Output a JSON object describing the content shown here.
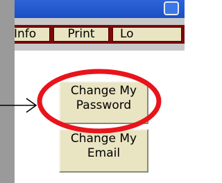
{
  "titlebar": {
    "button_icon": "window-restore-icon",
    "color": "#1a4fc4"
  },
  "nav": {
    "tabs": [
      {
        "label": "Info"
      },
      {
        "label": "Print"
      },
      {
        "label": "Lo"
      }
    ],
    "bar_color": "#7a0a0a",
    "tab_color": "#e9e4c2"
  },
  "actions": {
    "change_password": {
      "line1": "Change My",
      "line2": "Password"
    },
    "change_email": {
      "line1": "Change My",
      "line2": "Email"
    }
  },
  "annotation": {
    "highlight_color": "#e8141c",
    "arrow_icon": "arrow-right-icon",
    "circle_icon": "highlight-ellipse"
  }
}
